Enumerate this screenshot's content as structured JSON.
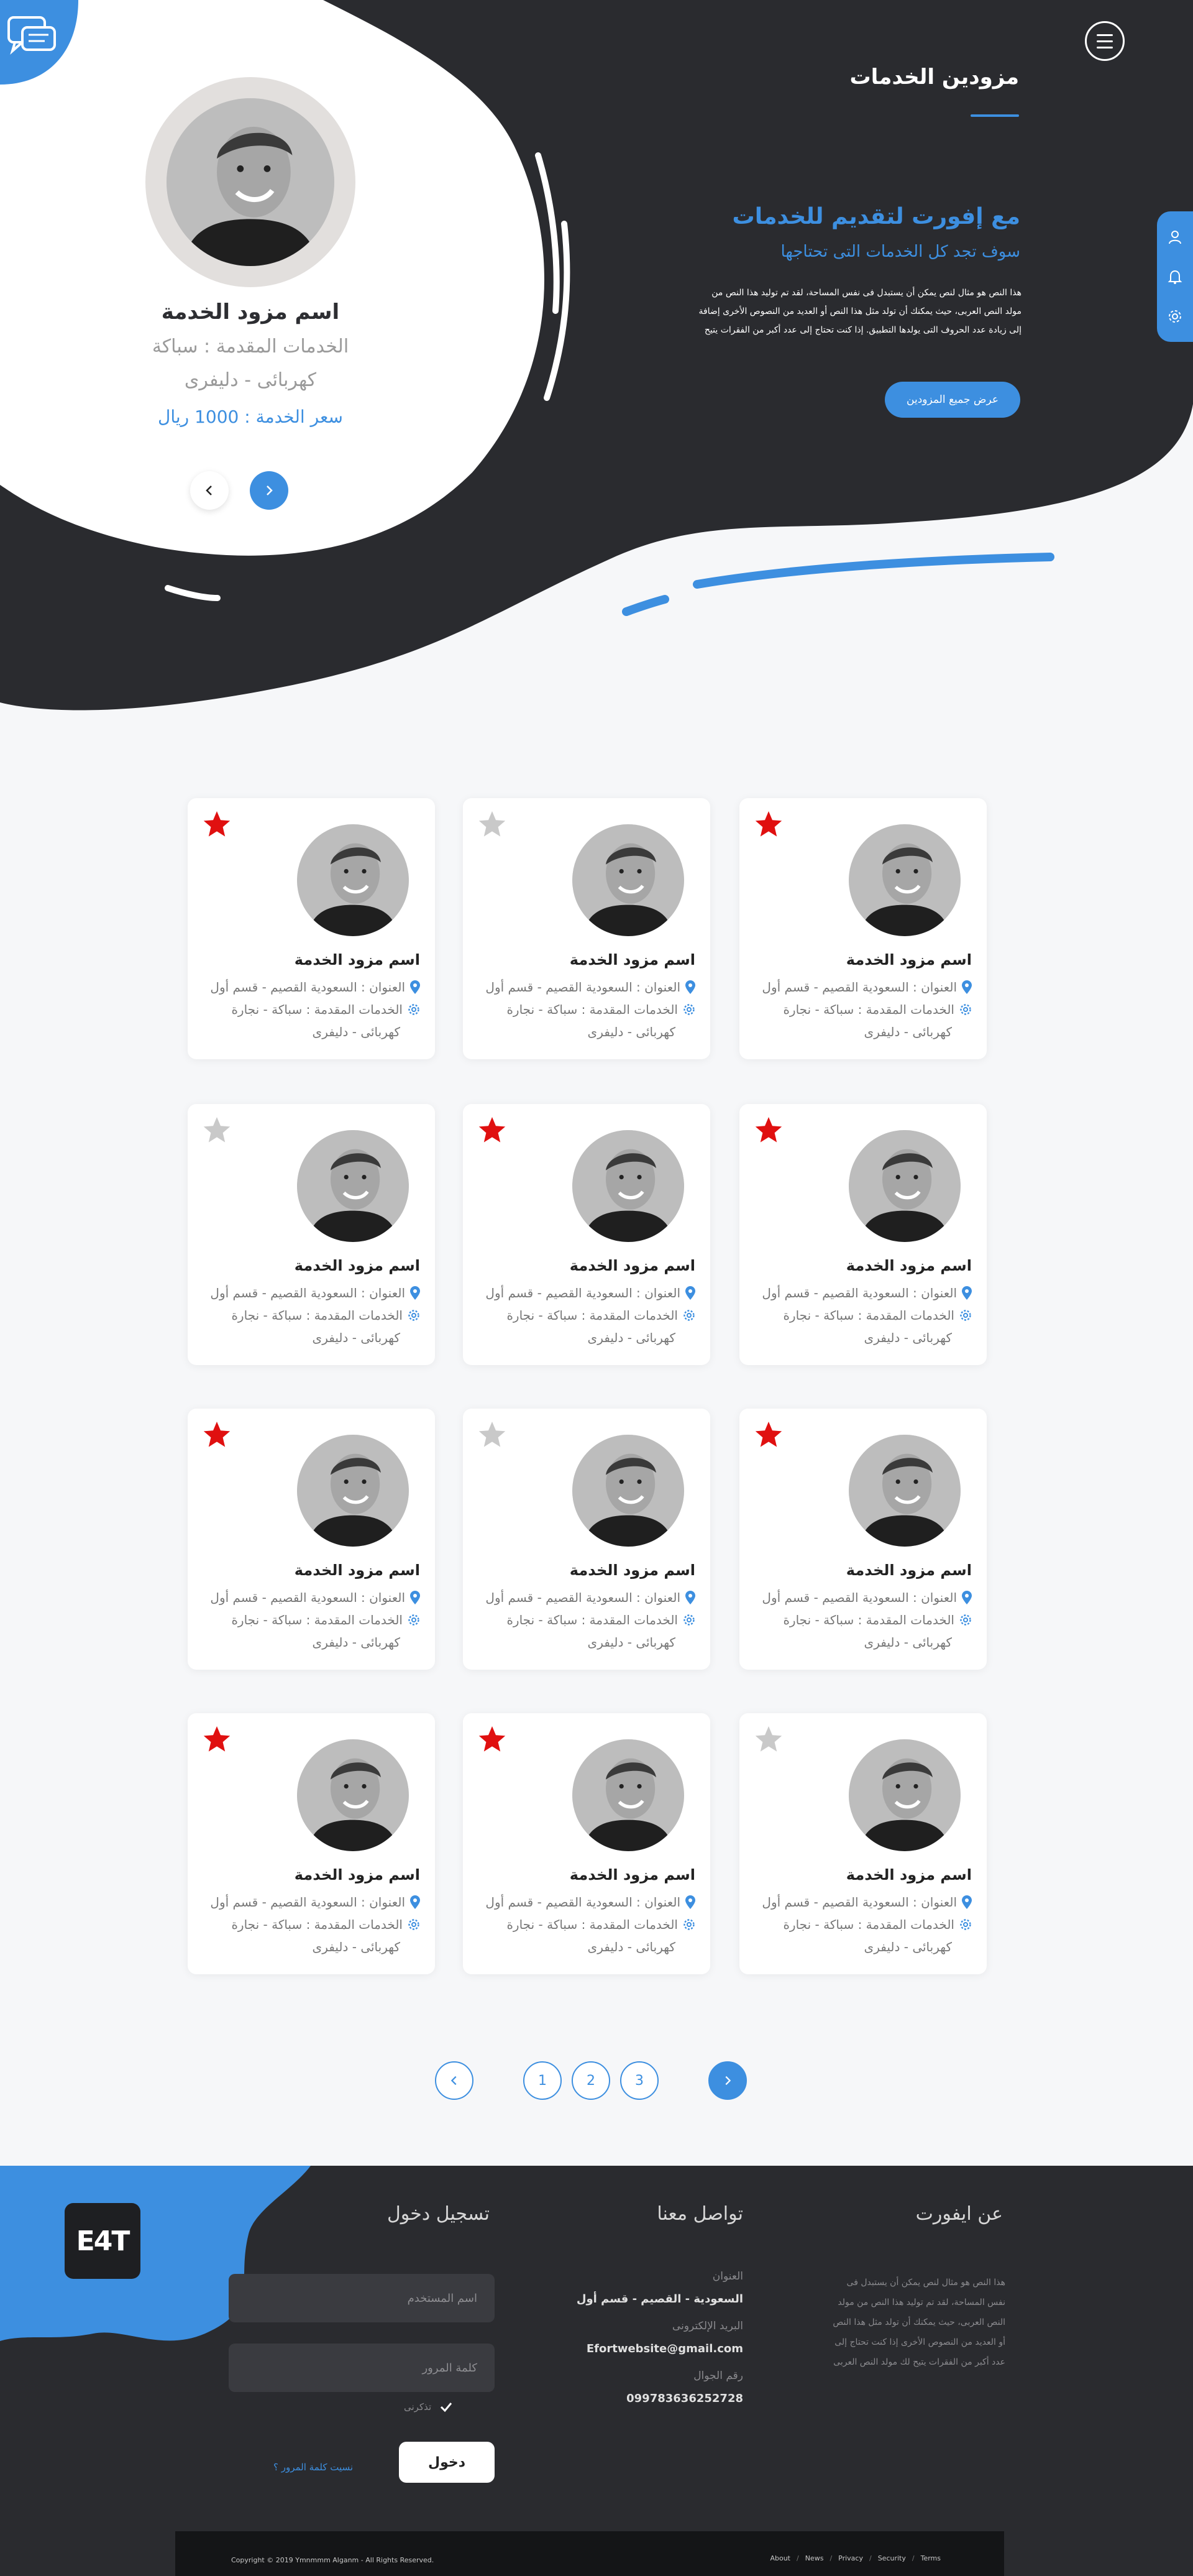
{
  "header": {
    "title": "مزودين الخدمات"
  },
  "intro": {
    "heading": "مع إفورت لتقديم للخدمات",
    "subheading": "سوف تجد كل الخدمات التى تحتاجها",
    "body": "هذا النص هو مثال لنص يمكن أن يستبدل فى نفس المساحة، لقد تم توليد هذا النص من مولد النص العربى، حيث يمكنك أن تولد مثل هذا النص أو العديد من النصوص الأخرى إضافة إلى زيادة عدد الحروف التى يولدها التطبيق. إذا كنت تحتاج إلى عدد أكبر من الفقرات يتيح لك مولد النص العربى",
    "button": "عرض جميع المزودين"
  },
  "featured": {
    "name": "اسم مزود الخدمة",
    "services": "الخدمات المقدمة : سباكة",
    "tags": "كهربائى - دليفرى",
    "price": "سعر الخدمة : 1000 ريال"
  },
  "providers": [
    {
      "name": "اسم مزود الخدمة",
      "address": "العنوان : السعودية القصيم - قسم أول",
      "services": "الخدمات المقدمة : سباكة - نجارة",
      "extra": "كهربائى - دليفرى",
      "favorite": true
    },
    {
      "name": "اسم مزود الخدمة",
      "address": "العنوان : السعودية القصيم - قسم أول",
      "services": "الخدمات المقدمة : سباكة - نجارة",
      "extra": "كهربائى - دليفرى",
      "favorite": false
    },
    {
      "name": "اسم مزود الخدمة",
      "address": "العنوان : السعودية القصيم - قسم أول",
      "services": "الخدمات المقدمة : سباكة - نجارة",
      "extra": "كهربائى - دليفرى",
      "favorite": true
    },
    {
      "name": "اسم مزود الخدمة",
      "address": "العنوان : السعودية القصيم - قسم أول",
      "services": "الخدمات المقدمة : سباكة - نجارة",
      "extra": "كهربائى - دليفرى",
      "favorite": true
    },
    {
      "name": "اسم مزود الخدمة",
      "address": "العنوان : السعودية القصيم - قسم أول",
      "services": "الخدمات المقدمة : سباكة - نجارة",
      "extra": "كهربائى - دليفرى",
      "favorite": true
    },
    {
      "name": "اسم مزود الخدمة",
      "address": "العنوان : السعودية القصيم - قسم أول",
      "services": "الخدمات المقدمة : سباكة - نجارة",
      "extra": "كهربائى - دليفرى",
      "favorite": false
    },
    {
      "name": "اسم مزود الخدمة",
      "address": "العنوان : السعودية القصيم - قسم أول",
      "services": "الخدمات المقدمة : سباكة - نجارة",
      "extra": "كهربائى - دليفرى",
      "favorite": true
    },
    {
      "name": "اسم مزود الخدمة",
      "address": "العنوان : السعودية القصيم - قسم أول",
      "services": "الخدمات المقدمة : سباكة - نجارة",
      "extra": "كهربائى - دليفرى",
      "favorite": false
    },
    {
      "name": "اسم مزود الخدمة",
      "address": "العنوان : السعودية القصيم - قسم أول",
      "services": "الخدمات المقدمة : سباكة - نجارة",
      "extra": "كهربائى - دليفرى",
      "favorite": true
    },
    {
      "name": "اسم مزود الخدمة",
      "address": "العنوان : السعودية القصيم - قسم أول",
      "services": "الخدمات المقدمة : سباكة - نجارة",
      "extra": "كهربائى - دليفرى",
      "favorite": false
    },
    {
      "name": "اسم مزود الخدمة",
      "address": "العنوان : السعودية القصيم - قسم أول",
      "services": "الخدمات المقدمة : سباكة - نجارة",
      "extra": "كهربائى - دليفرى",
      "favorite": true
    },
    {
      "name": "اسم مزود الخدمة",
      "address": "العنوان : السعودية القصيم - قسم أول",
      "services": "الخدمات المقدمة : سباكة - نجارة",
      "extra": "كهربائى - دليفرى",
      "favorite": true
    }
  ],
  "pagination": {
    "pages": [
      "1",
      "2",
      "3"
    ]
  },
  "footer": {
    "logo_text": "E4T",
    "about": {
      "heading": "عن ايفورت",
      "text": "هذا النص هو مثال لنص يمكن أن يستبدل فى نفس المساحة، لقد تم توليد هذا النص من مولد النص العربى، حيث يمكنك أن تولد مثل هذا النص أو العديد من النصوص الأخرى إذا كنت تحتاج إلى عدد أكبر من الفقرات يتيح لك مولد النص العربى"
    },
    "contact": {
      "heading": "تواصل معنا",
      "address_label": "العنوان",
      "address_value": "السعودية - القصيم - قسم أول",
      "email_label": "البريد الإلكترونى",
      "email_value": "Efortwebsite@gmail.com",
      "phone_label": "رقم الجوال",
      "phone_value": "099783636252728"
    },
    "login": {
      "heading": "تسجيل دخول",
      "username_placeholder": "اسم المستخدم",
      "password_placeholder": "كلمة المرور",
      "remember": "تذكرنى",
      "forgot": "نسيت كلمة المرور ؟",
      "submit": "دخول"
    },
    "copyright": "Copyright © 2019 Ymnmmm Alganm - All Rights Reserved.",
    "links": [
      "About",
      "News",
      "Privacy",
      "Security",
      "Terms"
    ]
  },
  "colors": {
    "accent": "#3d8fe0",
    "dark": "#2a2b2f",
    "star_active": "#e01010",
    "star_inactive": "#c9c9c9"
  }
}
